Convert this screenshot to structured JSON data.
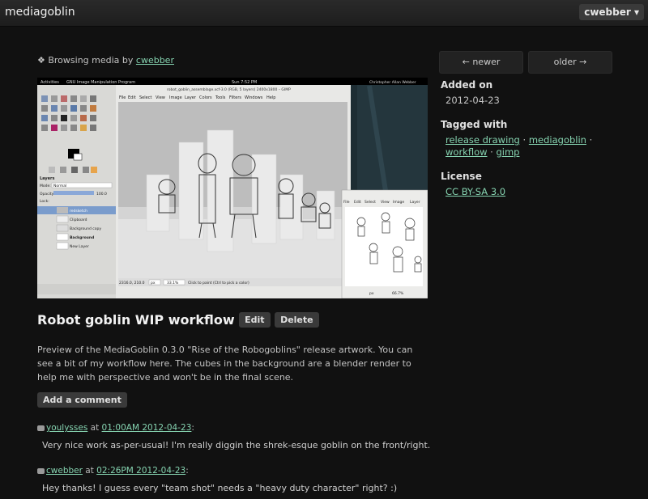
{
  "header": {
    "logo": "mediagoblin",
    "user_label": "cwebber ▾"
  },
  "browsing": {
    "prefix": "❖ Browsing media by ",
    "user": "cwebber"
  },
  "media": {
    "screen_bar_left": "Activities",
    "screen_bar_app": "GNU Image Manipulation Program",
    "screen_bar_time": "Sun 7:52 PM",
    "screen_bar_user": "Christopher Allan Webber",
    "window_title": "robot_goblin_assemblage.xcf-3.0 (RGB, 5 layers) 2400x1800 – GIMP",
    "menu": [
      "File",
      "Edit",
      "Select",
      "View",
      "Image",
      "Layer",
      "Colors",
      "Tools",
      "Filters",
      "Windows",
      "Help"
    ],
    "small_menu": [
      "File",
      "Edit",
      "Select",
      "View",
      "Image",
      "Layer"
    ],
    "layers_title": "Layers",
    "mode_label": "Mode:",
    "mode_value": "Normal",
    "opacity_label": "Opacity:",
    "opacity_value": "100.0",
    "lock_label": "Lock:",
    "layers": [
      "redsketch",
      "Clipboard",
      "Background copy",
      "Background",
      "New Layer"
    ],
    "status_coords": "2316.0, 210.0",
    "status_unit": "px",
    "status_zoom": "33.1%",
    "status_hint": "Click to paint (Ctrl to pick a color)",
    "small_zoom": "66.7%"
  },
  "title": "Robot goblin WIP workflow",
  "edit_label": "Edit",
  "delete_label": "Delete",
  "description": "Preview of the MediaGoblin 0.3.0 \"Rise of the Robogoblins\" release artwork. You can see a bit of my workflow here. The cubes in the background are a blender render to help me with perspective and won't be in the final scene.",
  "add_comment_label": "Add a comment",
  "comments": [
    {
      "author": "youlysses",
      "at": " at ",
      "time": "01:00AM 2012-04-23",
      "colon": ":",
      "text": "Very nice work as-per-usual! I'm really diggin the shrek-esque goblin on the front/right."
    },
    {
      "author": "cwebber",
      "at": " at ",
      "time": "02:26PM 2012-04-23",
      "colon": ":",
      "text": "Hey thanks! I guess every \"team shot\" needs a \"heavy duty character\" right? :)"
    }
  ],
  "sidebar": {
    "newer_label": "← newer",
    "older_label": "older →",
    "added_heading": "Added on",
    "added_date": "2012-04-23",
    "tagged_heading": "Tagged with",
    "tags": [
      "release drawing",
      "mediagoblin",
      "workflow",
      "gimp"
    ],
    "tag_sep": " · ",
    "license_heading": "License",
    "license": "CC BY-SA 3.0"
  }
}
